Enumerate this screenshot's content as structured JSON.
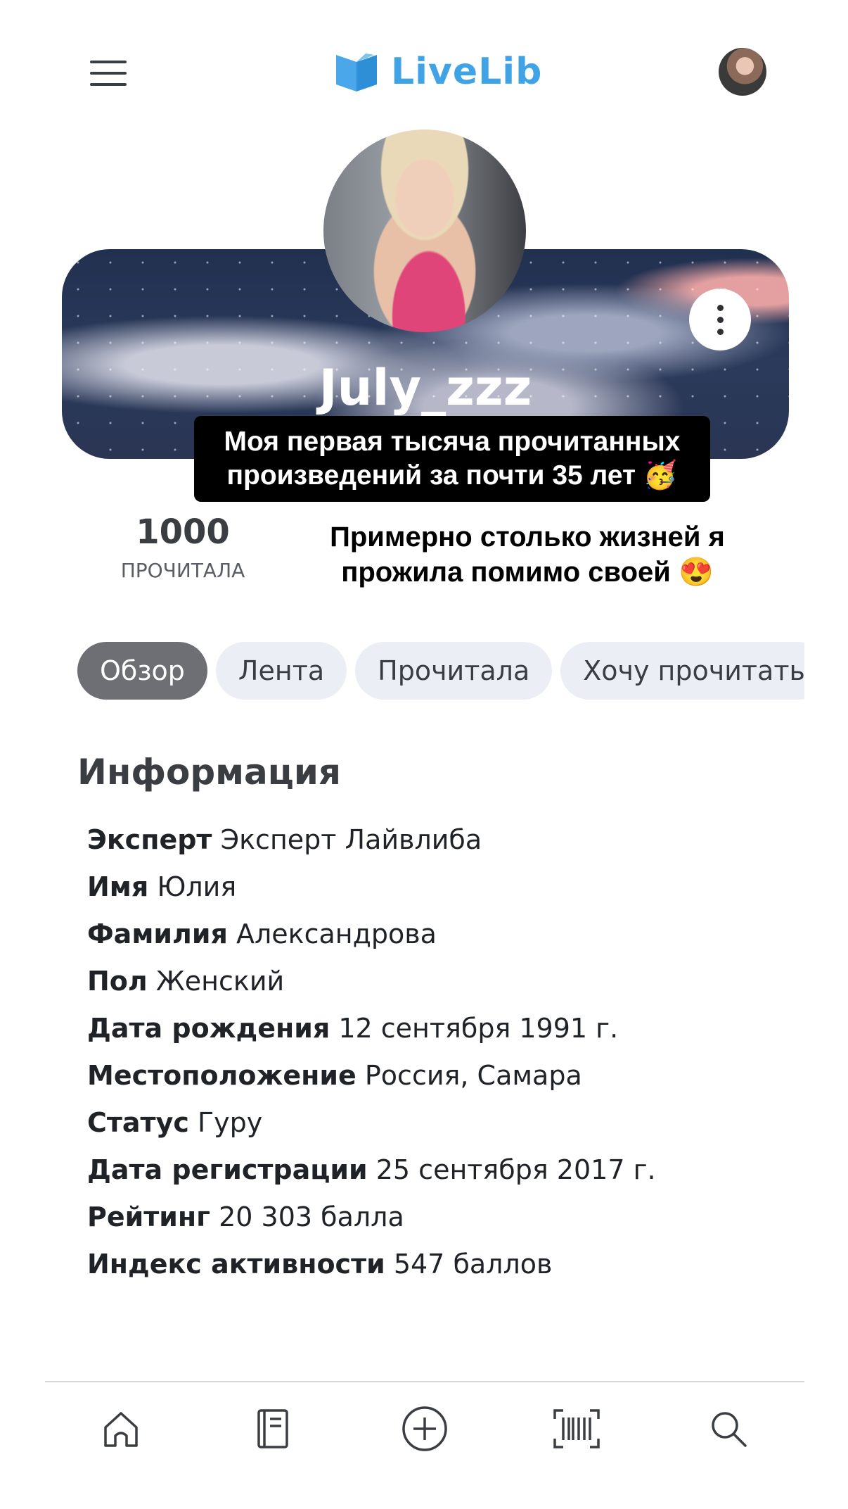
{
  "header": {
    "logo_text": "LiveLib",
    "logo_color": "#3fa3e6"
  },
  "profile": {
    "username": "July_zzz",
    "caption_line1": "Моя первая тысяча прочитанных",
    "caption_line2": "произведений за почти 35 лет 🥳",
    "read_count": "1000",
    "read_label": "ПРОЧИТАЛА",
    "quote_line1": "Примерно столько жизней я",
    "quote_line2": "прожила помимо своей 😍"
  },
  "tabs": [
    {
      "label": "Обзор",
      "active": true
    },
    {
      "label": "Лента"
    },
    {
      "label": "Прочитала"
    },
    {
      "label": "Хочу прочитать"
    }
  ],
  "info": {
    "title": "Информация",
    "rows": [
      {
        "key": "Эксперт",
        "value": "Эксперт Лайвлиба"
      },
      {
        "key": "Имя",
        "value": "Юлия"
      },
      {
        "key": "Фамилия",
        "value": "Александрова"
      },
      {
        "key": "Пол",
        "value": "Женский"
      },
      {
        "key": "Дата рождения",
        "value": "12 сентября 1991 г."
      },
      {
        "key": "Местоположение",
        "value": "Россия, Самара"
      },
      {
        "key": "Статус",
        "value": "Гуру"
      },
      {
        "key": "Дата регистрации",
        "value": "25 сентября 2017 г."
      },
      {
        "key": "Рейтинг",
        "value": "20 303 балла"
      },
      {
        "key": "Индекс активности",
        "value": "547 баллов"
      }
    ]
  },
  "bottom_nav": [
    {
      "icon": "home-icon"
    },
    {
      "icon": "book-icon"
    },
    {
      "icon": "add-icon"
    },
    {
      "icon": "barcode-icon"
    },
    {
      "icon": "search-icon"
    }
  ]
}
